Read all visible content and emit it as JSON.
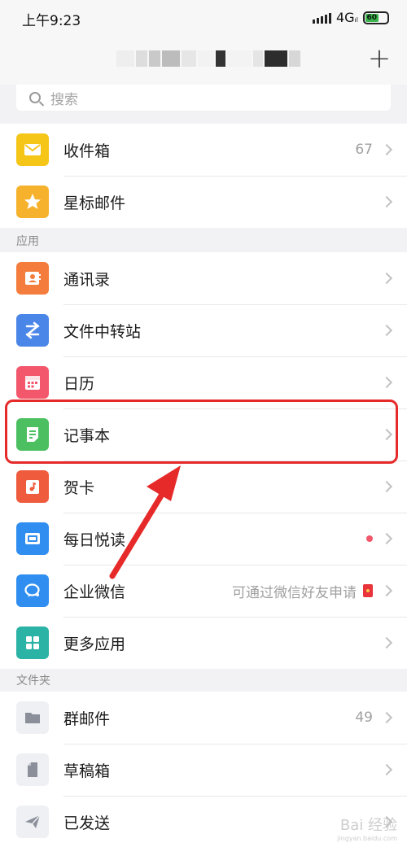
{
  "status_bar": {
    "time": "上午9:23",
    "network": "4G",
    "battery": "60",
    "battery_color": "#39b54a"
  },
  "header": {
    "plus_icon": "plus-icon"
  },
  "search": {
    "placeholder": "搜索"
  },
  "mail_items": [
    {
      "label": "收件箱",
      "count": "67",
      "icon": "inbox-envelope-icon",
      "color": "#f5c518"
    },
    {
      "label": "星标邮件",
      "icon": "star-icon",
      "color": "#f6b22c"
    }
  ],
  "apps_section": {
    "title": "应用",
    "items": [
      {
        "label": "通讯录",
        "icon": "contacts-icon",
        "color": "#f47c3c"
      },
      {
        "label": "文件中转站",
        "icon": "file-transfer-icon",
        "color": "#4a86e8"
      },
      {
        "label": "日历",
        "icon": "calendar-icon",
        "color": "#f2576c"
      },
      {
        "label": "记事本",
        "icon": "notepad-icon",
        "color": "#4cc061"
      },
      {
        "label": "贺卡",
        "icon": "greeting-card-icon",
        "color": "#ef5b3d"
      },
      {
        "label": "每日悦读",
        "icon": "daily-reading-icon",
        "color": "#2f8ef0"
      },
      {
        "label": "企业微信",
        "meta": "可通过微信好友申请",
        "icon": "wecom-icon",
        "color": "#2f8ef0"
      },
      {
        "label": "更多应用",
        "icon": "more-apps-icon",
        "color": "#2bb3a5"
      }
    ]
  },
  "folders_section": {
    "title": "文件夹",
    "items": [
      {
        "label": "群邮件",
        "count": "49",
        "icon": "folder-icon",
        "color": "#8a8f99"
      },
      {
        "label": "草稿箱",
        "icon": "draft-icon",
        "color": "#8a8f99"
      },
      {
        "label": "已发送",
        "icon": "sent-icon",
        "color": "#8a8f99"
      }
    ]
  },
  "annotation": {
    "highlight_color": "#e62a2a"
  },
  "watermark": {
    "text": "Bai 经验",
    "sub": "jingyan.baidu.com"
  }
}
